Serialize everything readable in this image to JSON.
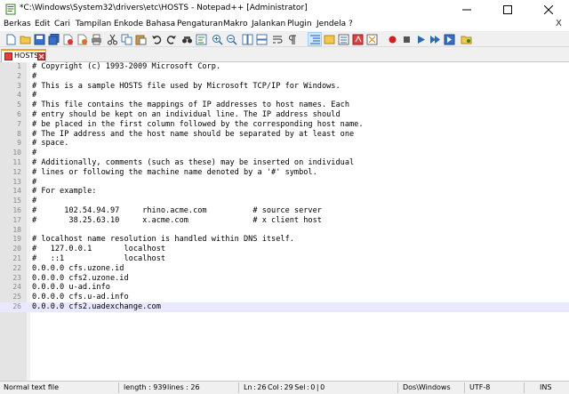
{
  "window": {
    "title": "*C:\\Windows\\System32\\drivers\\etc\\HOSTS - Notepad++ [Administrator]"
  },
  "menu": {
    "items": [
      "Berkas",
      "Edit",
      "Cari",
      "Tampilan",
      "Enkode",
      "Bahasa",
      "Pengaturan",
      "Makro",
      "Jalankan",
      "Plugin",
      "Jendela",
      "?"
    ],
    "close_glyph": "X"
  },
  "toolbar": {
    "buttons": [
      "new-file",
      "open-file",
      "save",
      "save-all",
      "close",
      "close-all",
      "print",
      "cut",
      "copy",
      "paste",
      "undo",
      "redo",
      "find",
      "replace",
      "zoom-in",
      "zoom-out",
      "sync-vertical",
      "sync-horizontal",
      "word-wrap",
      "show-all-chars",
      "indent-guide",
      "language",
      "function-list",
      "folder-workspace",
      "document-map",
      "start-recording",
      "stop-recording",
      "playback",
      "run-multiple",
      "save-macro",
      "monitoring"
    ]
  },
  "tabs": [
    {
      "label": "HOSTS",
      "modified": true
    }
  ],
  "editor": {
    "current_line": 26,
    "lines": [
      {
        "n": "1",
        "text": "# Copyright (c) 1993-2009 Microsoft Corp."
      },
      {
        "n": "2",
        "text": "#"
      },
      {
        "n": "3",
        "text": "# This is a sample HOSTS file used by Microsoft TCP/IP for Windows."
      },
      {
        "n": "4",
        "text": "#"
      },
      {
        "n": "5",
        "text": "# This file contains the mappings of IP addresses to host names. Each"
      },
      {
        "n": "6",
        "text": "# entry should be kept on an individual line. The IP address should"
      },
      {
        "n": "7",
        "text": "# be placed in the first column followed by the corresponding host name."
      },
      {
        "n": "8",
        "text": "# The IP address and the host name should be separated by at least one"
      },
      {
        "n": "9",
        "text": "# space."
      },
      {
        "n": "10",
        "text": "#"
      },
      {
        "n": "11",
        "text": "# Additionally, comments (such as these) may be inserted on individual"
      },
      {
        "n": "12",
        "text": "# lines or following the machine name denoted by a '#' symbol."
      },
      {
        "n": "13",
        "text": "#"
      },
      {
        "n": "14",
        "text": "# For example:"
      },
      {
        "n": "15",
        "text": "#"
      },
      {
        "n": "16",
        "text": "#      102.54.94.97     rhino.acme.com          # source server"
      },
      {
        "n": "17",
        "text": "#       38.25.63.10     x.acme.com              # x client host"
      },
      {
        "n": "18",
        "text": ""
      },
      {
        "n": "19",
        "text": "# localhost name resolution is handled within DNS itself."
      },
      {
        "n": "20",
        "text": "#   127.0.0.1       localhost"
      },
      {
        "n": "21",
        "text": "#   ::1             localhost"
      },
      {
        "n": "22",
        "text": "0.0.0.0 cfs.uzone.id"
      },
      {
        "n": "23",
        "text": "0.0.0.0 cfs2.uzone.id"
      },
      {
        "n": "24",
        "text": "0.0.0.0 u-ad.info"
      },
      {
        "n": "25",
        "text": "0.0.0.0 cfs.u-ad.info"
      },
      {
        "n": "26",
        "text": "0.0.0.0 cfs2.uadexchange.com"
      }
    ]
  },
  "status": {
    "file_type": "Normal text file",
    "length": "length : 939",
    "lines": "lines : 26",
    "position": "Ln : 26    Col : 29    Sel : 0 | 0",
    "eol": "Dos\\Windows",
    "encoding": "UTF-8",
    "mode": "INS"
  },
  "colors": {
    "tab_accent": "#f9a01b",
    "current_line": "#e8e8ff",
    "gutter": "#e4e4e4",
    "close_tab": "#d63a3a"
  }
}
